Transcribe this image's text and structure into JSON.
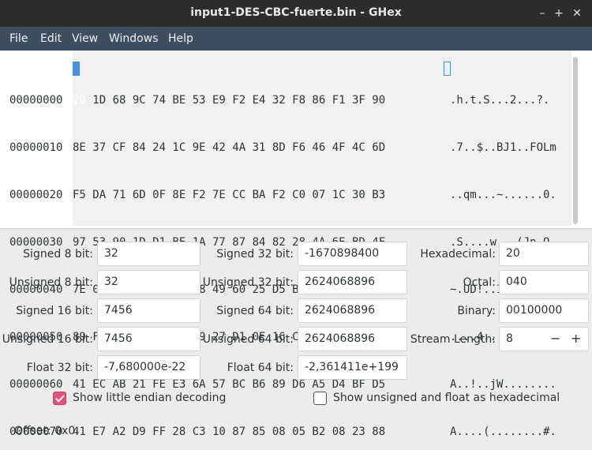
{
  "window": {
    "title": "input1-DES-CBC-fuerte.bin - GHex",
    "minimize": "–",
    "maximize": "+",
    "close": "✕"
  },
  "menu": [
    "File",
    "Edit",
    "View",
    "Windows",
    "Help"
  ],
  "hex_view": {
    "offsets": [
      "00000000",
      "00000010",
      "00000020",
      "00000030",
      "00000040",
      "00000050",
      "00000060",
      "00000070"
    ],
    "first_byte": "20",
    "first_row_rest": " 1D 68 9C 74 BE 53 E9 F2 E4 32 F8 86 F1 3F 90",
    "hex_rows": [
      "8E 37 CF 84 24 1C 9E 42 4A 31 8D F6 46 4F 4C 6D",
      "F5 DA 71 6D 0F 8E F2 7E CC BA F2 C0 07 1C 30 B3",
      "97 53 90 1D D1 BE 1A 77 87 84 82 28 4A 6E BD 4F",
      "7E 04 55 44 21 89 A8 49 60 25 D5 BE 46 86 CF B2",
      "89 F0 B0 D9 34 B1 F9 27 D1 0E 16 CB 6C 1D 64 19",
      "41 EC AB 21 FE E3 6A 57 BC B6 89 D6 A5 D4 BF D5",
      "41 E7 A2 D9 FF 28 C3 10 87 85 08 05 B2 08 23 88"
    ],
    "ascii_rows": [
      ".h.t.S...2...?.",
      ".7..$..BJ1..FOLm",
      "..qm...~......0.",
      ".S....w...(Jn.O",
      "~.UD!..I`%..F...",
      "....4..'....l.d.",
      "A..!..jW........",
      "A....(........#."
    ]
  },
  "fields": {
    "signed8": {
      "label": "Signed 8 bit:",
      "value": "32"
    },
    "unsigned8": {
      "label": "Unsigned 8 bit:",
      "value": "32"
    },
    "signed16": {
      "label": "Signed 16 bit:",
      "value": "7456"
    },
    "unsigned16": {
      "label": "Unsigned 16 bit:",
      "value": "7456"
    },
    "float32": {
      "label": "Float 32 bit:",
      "value": "-7,680000e-22"
    },
    "signed32": {
      "label": "Signed 32 bit:",
      "value": "-1670898400"
    },
    "unsigned32": {
      "label": "Unsigned 32 bit:",
      "value": "2624068896"
    },
    "signed64": {
      "label": "Signed 64 bit:",
      "value": "2624068896"
    },
    "unsigned64": {
      "label": "Unsigned 64 bit:",
      "value": "2624068896"
    },
    "float64": {
      "label": "Float 64 bit:",
      "value": "-2,361411e+199"
    },
    "hexadecimal": {
      "label": "Hexadecimal:",
      "value": "20"
    },
    "octal": {
      "label": "Octal:",
      "value": "040"
    },
    "binary": {
      "label": "Binary:",
      "value": "00100000"
    },
    "stream_length": {
      "label": "Stream Length:",
      "value": "8",
      "minus": "−",
      "plus": "+"
    }
  },
  "options": {
    "little_endian": {
      "label": "Show little endian decoding",
      "checked": true
    },
    "unsigned_hex": {
      "label": "Show unsigned and float as hexadecimal",
      "checked": false
    }
  },
  "status": {
    "offset": "Offset: 0x0"
  },
  "colors": {
    "menubar": "#3c4e60",
    "cursor": "#4a90d9",
    "checkbox": "#e8507a"
  }
}
